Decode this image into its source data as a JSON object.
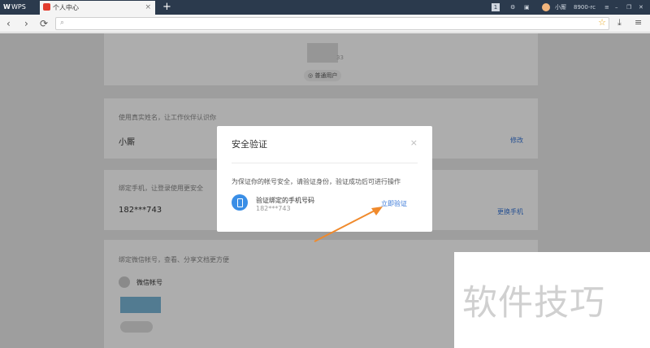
{
  "tabs": {
    "wps_label": "WPS",
    "active_label": "个人中心",
    "new_tab": "+"
  },
  "topbar": {
    "badge": "1",
    "user": "小厮",
    "points": "8900-rc"
  },
  "nav": {
    "back": "‹",
    "forward": "›",
    "reload": "⟳",
    "search_icon": "search-icon",
    "star": "☆",
    "download": "⤓",
    "menu": "≡"
  },
  "profile": {
    "user_type": "普通用户",
    "digits": "33"
  },
  "name_card": {
    "desc": "使用真实姓名，让工作伙伴认识你",
    "value": "小厮",
    "action": "修改"
  },
  "phone_card": {
    "desc": "绑定手机，让登录使用更安全",
    "value": "182***743",
    "action": "更换手机"
  },
  "wechat_card": {
    "desc": "绑定微信帐号，查看、分享文档更方便",
    "label": "微信帐号"
  },
  "dialog": {
    "title": "安全验证",
    "close": "×",
    "desc": "为保证你的帐号安全，请验证身份，验证成功后可进行操作",
    "method": "验证绑定的手机号码",
    "phone": "182***743",
    "verify": "立即验证"
  },
  "watermark": "软件技巧",
  "colors": {
    "accent": "#3a78d8",
    "arrow": "#f08a2c",
    "tabbar": "#2b3a4d"
  }
}
